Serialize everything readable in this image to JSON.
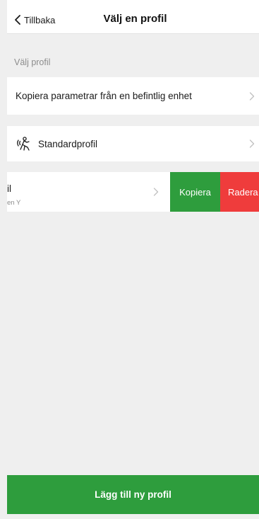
{
  "header": {
    "back_label": "Tillbaka",
    "title": "Välj en profil"
  },
  "section": {
    "caption": "Välj profil"
  },
  "rows": {
    "copy_from_device": "Kopiera parametrar från en befintlig enhet",
    "standard_profile": "Standardprofil"
  },
  "swiped_row": {
    "title_fragment": "il",
    "subtitle_fragment": "en Y",
    "copy_action": "Kopiera",
    "delete_action": "Radera"
  },
  "footer": {
    "add_profile_label": "Lägg till ny profil"
  },
  "icons": {
    "back": "chevron-left-icon",
    "row_chevron": "chevron-right-icon",
    "standard": "person-waves-icon"
  },
  "colors": {
    "accent_green": "#2e9d3d",
    "delete_red": "#ef3c3c",
    "background": "#efefef",
    "caption_gray": "#8c8c8c"
  }
}
